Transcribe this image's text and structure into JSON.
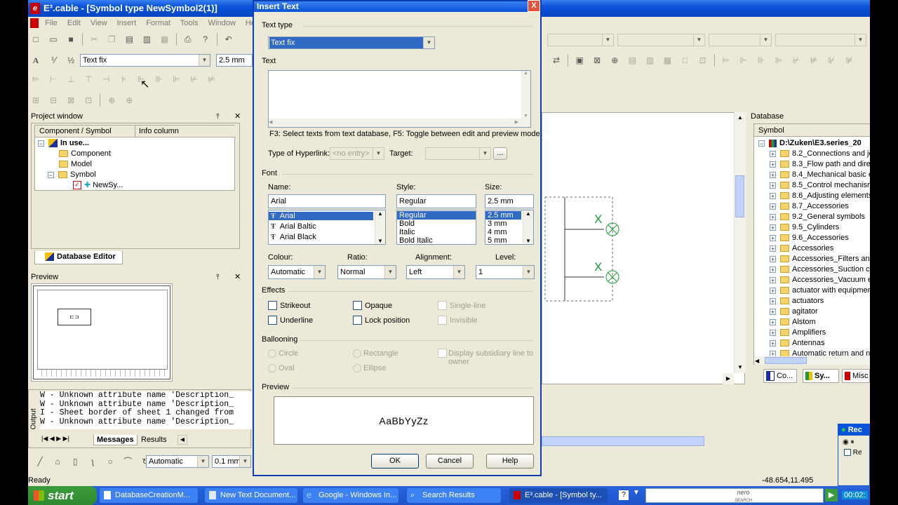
{
  "app": {
    "title": "E³.cable - [Symbol type NewSymbol2(1)]",
    "menu": [
      "File",
      "Edit",
      "View",
      "Insert",
      "Format",
      "Tools",
      "Window",
      "Help"
    ],
    "toolbar": {
      "text_type_combo": "Text fix",
      "size_combo": "2.5 mm",
      "draw_colour_combo": "Automatic",
      "line_width_combo": "0.1 mm"
    },
    "project_window": {
      "title": "Project window",
      "col1": "Component / Symbol",
      "col2": "Info column",
      "root": "In use...",
      "items": [
        "Component",
        "Model",
        "Symbol"
      ],
      "symbol_child": "NewSy...",
      "tab": "Database Editor"
    },
    "preview_panel": {
      "title": "Preview"
    },
    "output": {
      "label": "Output",
      "lines": [
        "W - Unknown attribute name 'Description_",
        "W - Unknown attribute name 'Description_",
        "I - Sheet border of sheet 1 changed from",
        "W - Unknown attribute name 'Description_"
      ],
      "tabs": [
        "Messages",
        "Results"
      ]
    },
    "database": {
      "title": "Database",
      "header": "Symbol",
      "root": "D:\\Zuken\\E3.series_20",
      "items": [
        "8.2_Connections and jo",
        "8.3_Flow path and direc",
        "8.4_Mechanical basic e",
        "8.5_Control mechanism",
        "8.6_Adjusting elements",
        "8.7_Accessories",
        "9.2_General symbols",
        "9.5_Cylinders",
        "9.6_Accessories",
        "Accessories",
        "Accessories_Filters and",
        "Accessories_Suction cu",
        "Accessories_Vacuum e",
        "actuator with equipment",
        "actuators",
        "agitator",
        "Alstom",
        "Amplifiers",
        "Antennas",
        "Automatic return and no"
      ],
      "tabs": [
        "Co...",
        "Sy...",
        "Misc"
      ]
    },
    "canvas": {
      "marks": [
        "X",
        "X"
      ]
    },
    "status": {
      "left": "Ready",
      "coords": "-48.654,11.495"
    }
  },
  "dialog": {
    "title": "Insert Text",
    "close": "X",
    "text_type_label": "Text type",
    "text_type_value": "Text fix",
    "text_label": "Text",
    "hint": "F3: Select texts from text database, F5: Toggle between edit and preview mode.",
    "hyperlink_label": "Type of Hyperlink:",
    "hyperlink_value": "<no entry>",
    "target_label": "Target:",
    "browse": "...",
    "font_group": "Font",
    "name_label": "Name:",
    "name_value": "Arial",
    "name_list": [
      "Arial",
      "Arial Baltic",
      "Arial Black"
    ],
    "style_label": "Style:",
    "style_value": "Regular",
    "style_list": [
      "Regular",
      "Bold",
      "Italic",
      "Bold Italic"
    ],
    "size_label": "Size:",
    "size_value": "2.5 mm",
    "size_list": [
      "2.5 mm",
      "3 mm",
      "4 mm",
      "5 mm"
    ],
    "colour_label": "Colour:",
    "colour_value": "Automatic",
    "ratio_label": "Ratio:",
    "ratio_value": "Normal",
    "alignment_label": "Alignment:",
    "alignment_value": "Left",
    "level_label": "Level:",
    "level_value": "1",
    "effects_group": "Effects",
    "strikeout": "Strikeout",
    "underline": "Underline",
    "opaque": "Opaque",
    "lock_position": "Lock position",
    "single_line": "Single-line",
    "invisible": "Invisible",
    "ballooning_group": "Ballooning",
    "circle": "Circle",
    "oval": "Oval",
    "rectangle": "Rectangle",
    "ellipse": "Ellipse",
    "subsidiary_1": "Display subsidiary line to",
    "subsidiary_2": "owner",
    "preview_group": "Preview",
    "preview_sample": "AaBbYyZz",
    "ok": "OK",
    "cancel": "Cancel",
    "help": "Help"
  },
  "taskbar": {
    "start": "start",
    "tasks": [
      "DatabaseCreationM...",
      "New Text Document...",
      "Google - Windows In...",
      "Search Results",
      "E³.cable - [Symbol ty..."
    ],
    "nero": "nero",
    "nero_sub": "SEARCH",
    "clock": "00:02:",
    "rec_title": "Rec",
    "rec_check": "Re"
  }
}
